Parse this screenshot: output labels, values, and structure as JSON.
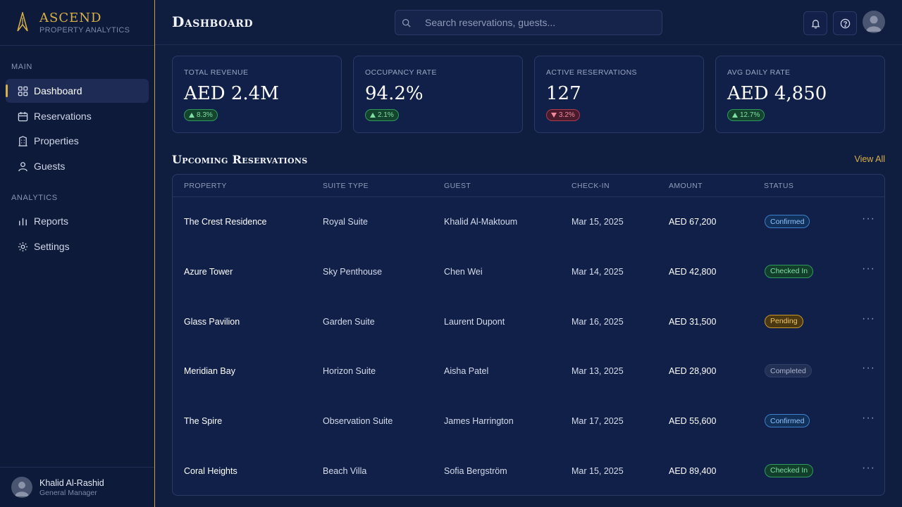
{
  "brand": {
    "name": "ASCEND",
    "subtitle": "PROPERTY ANALYTICS"
  },
  "sidebar": {
    "main_section": "MAIN",
    "analytics_section": "ANALYTICS",
    "items": [
      {
        "label": "Dashboard",
        "icon": "grid-icon",
        "active": true
      },
      {
        "label": "Reservations",
        "icon": "calendar-icon"
      },
      {
        "label": "Properties",
        "icon": "building-icon"
      },
      {
        "label": "Guests",
        "icon": "user-icon"
      },
      {
        "label": "Reports",
        "icon": "bar-chart-icon"
      },
      {
        "label": "Settings",
        "icon": "gear-icon"
      }
    ]
  },
  "user": {
    "name": "Khalid Al-Rashid",
    "role": "General Manager"
  },
  "header": {
    "title": "Dashboard",
    "search_placeholder": "Search reservations, guests..."
  },
  "kpis": [
    {
      "label": "TOTAL REVENUE",
      "value": "AED 2.4M",
      "change": "8.3%",
      "direction": "up"
    },
    {
      "label": "OCCUPANCY RATE",
      "value": "94.2%",
      "change": "2.1%",
      "direction": "up"
    },
    {
      "label": "ACTIVE RESERVATIONS",
      "value": "127",
      "change": "3.2%",
      "direction": "down"
    },
    {
      "label": "AVG DAILY RATE",
      "value": "AED 4,850",
      "change": "12.7%",
      "direction": "up"
    }
  ],
  "reservations": {
    "title": "Upcoming Reservations",
    "view_all": "View All",
    "columns": [
      "PROPERTY",
      "SUITE TYPE",
      "GUEST",
      "CHECK-IN",
      "AMOUNT",
      "STATUS"
    ],
    "rows": [
      {
        "property": "The Crest Residence",
        "suite": "Royal Suite",
        "guest": "Khalid Al-Maktoum",
        "checkin": "Mar 15, 2025",
        "amount": "AED 67,200",
        "status": "Confirmed"
      },
      {
        "property": "Azure Tower",
        "suite": "Sky Penthouse",
        "guest": "Chen Wei",
        "checkin": "Mar 14, 2025",
        "amount": "AED 42,800",
        "status": "Checked In"
      },
      {
        "property": "Glass Pavilion",
        "suite": "Garden Suite",
        "guest": "Laurent Dupont",
        "checkin": "Mar 16, 2025",
        "amount": "AED 31,500",
        "status": "Pending"
      },
      {
        "property": "Meridian Bay",
        "suite": "Horizon Suite",
        "guest": "Aisha Patel",
        "checkin": "Mar 13, 2025",
        "amount": "AED 28,900",
        "status": "Completed"
      },
      {
        "property": "The Spire",
        "suite": "Observation Suite",
        "guest": "James Harrington",
        "checkin": "Mar 17, 2025",
        "amount": "AED 55,600",
        "status": "Confirmed"
      },
      {
        "property": "Coral Heights",
        "suite": "Beach Villa",
        "guest": "Sofia Bergström",
        "checkin": "Mar 15, 2025",
        "amount": "AED 89,400",
        "status": "Checked In"
      }
    ]
  },
  "colors": {
    "accent": "#d8b04a",
    "background": "#0f1d3f",
    "sidebar": "#0e1a3a"
  }
}
